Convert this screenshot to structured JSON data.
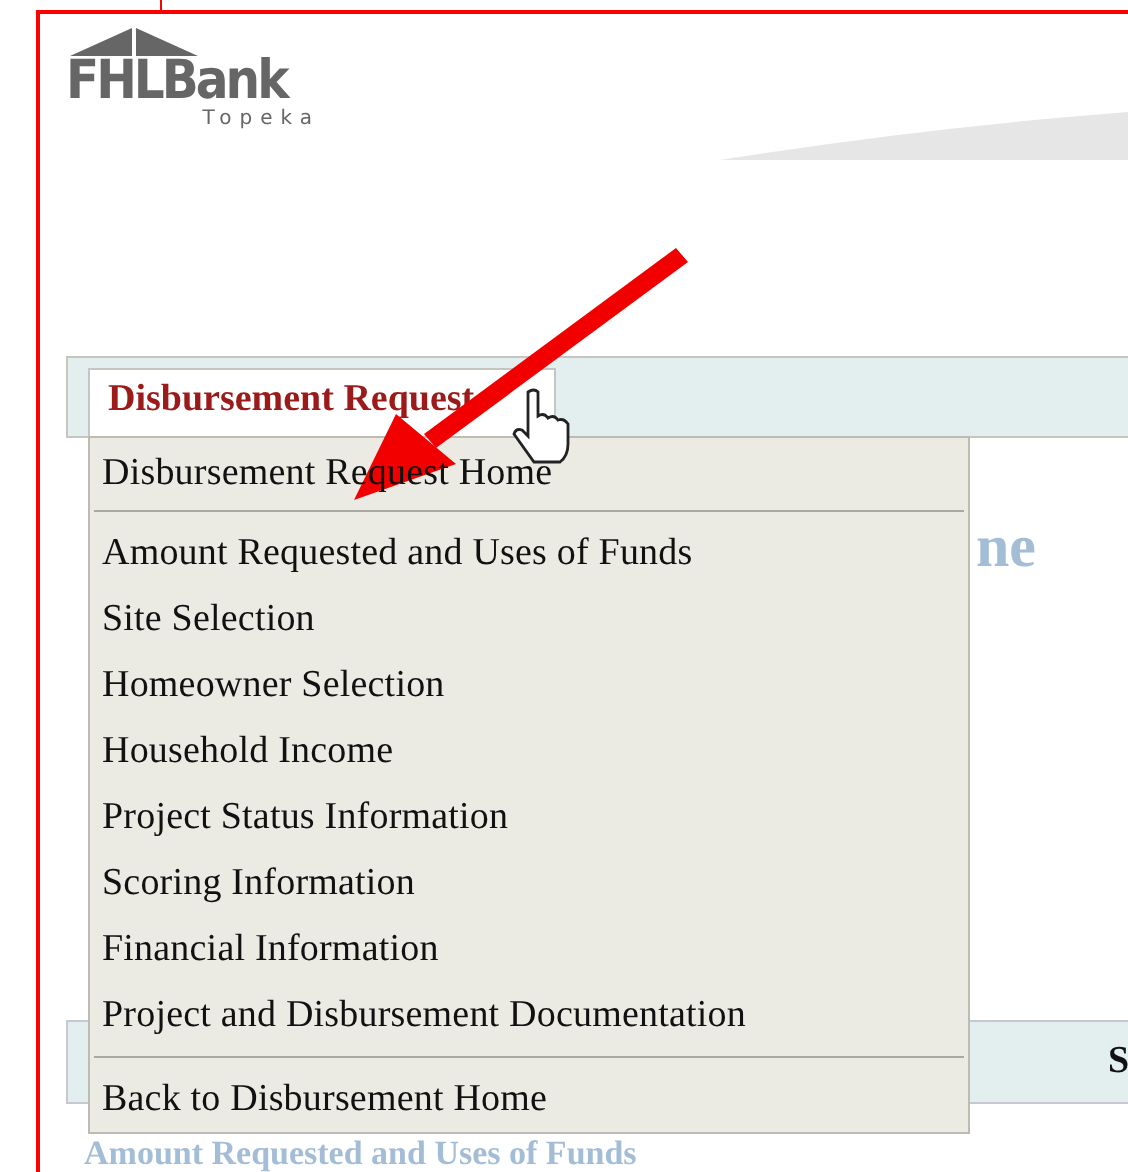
{
  "logo": {
    "name": "FHLBank",
    "subtitle": "Topeka"
  },
  "nav": {
    "tabs": [
      {
        "label": "Disbursement Request",
        "selected": true
      }
    ]
  },
  "menu": {
    "items": [
      {
        "label": "Disbursement Request Home",
        "separator_after": true
      },
      {
        "label": "Amount Requested and Uses of Funds",
        "separator_after": false
      },
      {
        "label": "Site Selection",
        "separator_after": false
      },
      {
        "label": "Homeowner Selection",
        "separator_after": false
      },
      {
        "label": "Household Income",
        "separator_after": false
      },
      {
        "label": "Project Status Information",
        "separator_after": false
      },
      {
        "label": "Scoring Information",
        "separator_after": false
      },
      {
        "label": "Financial Information",
        "separator_after": false
      },
      {
        "label": "Project and Disbursement Documentation",
        "separator_after": true
      },
      {
        "label": "Back to Disbursement Home",
        "separator_after": false
      }
    ]
  },
  "page_heading": {
    "visible_parts": [
      "ne"
    ]
  },
  "table": {
    "column_2_visible": "S"
  },
  "link": {
    "label": "Amount Requested and Uses of Funds"
  }
}
